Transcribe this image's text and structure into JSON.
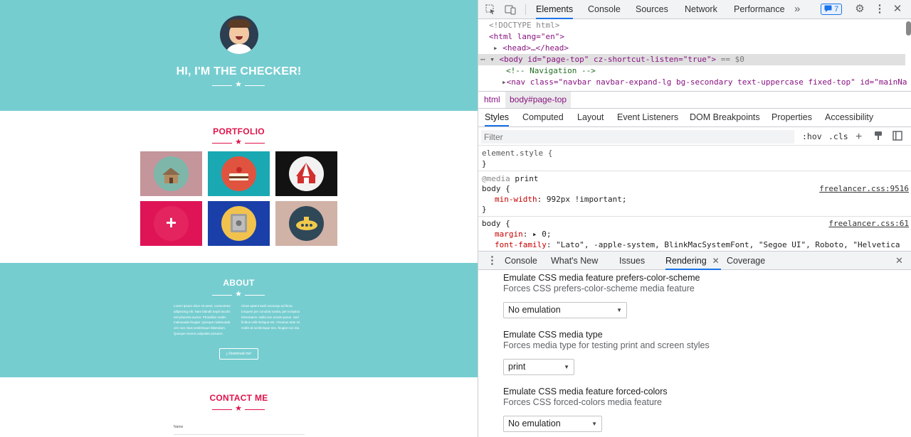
{
  "page": {
    "hero_title": "HI, I'M THE CHECKER!",
    "portfolio_title": "PORTFOLIO",
    "about_title": "ABOUT",
    "about_left": "Lorem ipsum dolor sit amet, consectetur adipiscing elit. Nam blandit turpis iaculis nisl pharetra auctor. Phasellus mattis malesuada feugiat. Quisque malesuada orci non risus scelerisque bibendum. Quisque viverra vulputate posuere.",
    "about_right": "Class aptent taciti sociosqu ad litora torquent per conubia nostra, per inceptos himenaeos. Nulla non ornare purus. Sed finibus velit tristique est. Vivamus ante mi, mollis at scelerisque nec, feugiat non dui.",
    "download_label": "⤓ Download me!",
    "contact_title": "CONTACT ME",
    "name_label": "Name",
    "star": "★",
    "plus": "+",
    "colors": {
      "teal": "#76cdd0",
      "accent": "#e0134b"
    },
    "portfolio_icons": [
      "cabin-icon",
      "cake-icon",
      "circus-tent-icon",
      "add-item-icon",
      "safe-icon",
      "submarine-icon"
    ]
  },
  "devtools": {
    "main_tabs": [
      "Elements",
      "Console",
      "Sources",
      "Network",
      "Performance"
    ],
    "more_tabs": "»",
    "issues_badge": "7",
    "dom": {
      "doctype": "<!DOCTYPE html>",
      "html_open": "<html lang=\"en\">",
      "head_line": "<head>…</head>",
      "body_line": "<body id=\"page-top\" cz-shortcut-listen=\"true\">",
      "body_suffix": "== $0",
      "comment": "<!-- Navigation -->",
      "nav_line": "<nav class=\"navbar navbar-expand-lg bg-secondary text-uppercase fixed-top\" id=\"mainNa"
    },
    "breadcrumbs": [
      "html",
      "body#page-top"
    ],
    "sub_tabs": [
      "Styles",
      "Computed",
      "Layout",
      "Event Listeners",
      "DOM Breakpoints",
      "Properties",
      "Accessibility"
    ],
    "filter_placeholder": "Filter",
    "hov": ":hov",
    "cls": ".cls",
    "styles": {
      "element_style": "element.style {",
      "close_brace": "}",
      "media": "@media",
      "media_type": "print",
      "body_sel": "body {",
      "link1": "freelancer.css:9516",
      "min_width_prop": "min-width",
      "min_width_val": ": 992px !important;",
      "link2": "freelancer.css:61",
      "margin_prop": "margin",
      "margin_val": ": ▸ 0;",
      "font_prop": "font-family",
      "font_val": ": \"Lato\", -apple-system, BlinkMacSystemFont, \"Segoe UI\", Roboto, \"Helvetica"
    },
    "drawer_tabs": [
      "Console",
      "What's New",
      "Issues",
      "Rendering",
      "Coverage"
    ],
    "rendering": [
      {
        "title": "Emulate CSS media feature prefers-color-scheme",
        "desc": "Forces CSS prefers-color-scheme media feature",
        "value": "No emulation"
      },
      {
        "title": "Emulate CSS media type",
        "desc": "Forces media type for testing print and screen styles",
        "value": "print"
      },
      {
        "title": "Emulate CSS media feature forced-colors",
        "desc": "Forces CSS forced-colors media feature",
        "value": "No emulation"
      }
    ]
  }
}
